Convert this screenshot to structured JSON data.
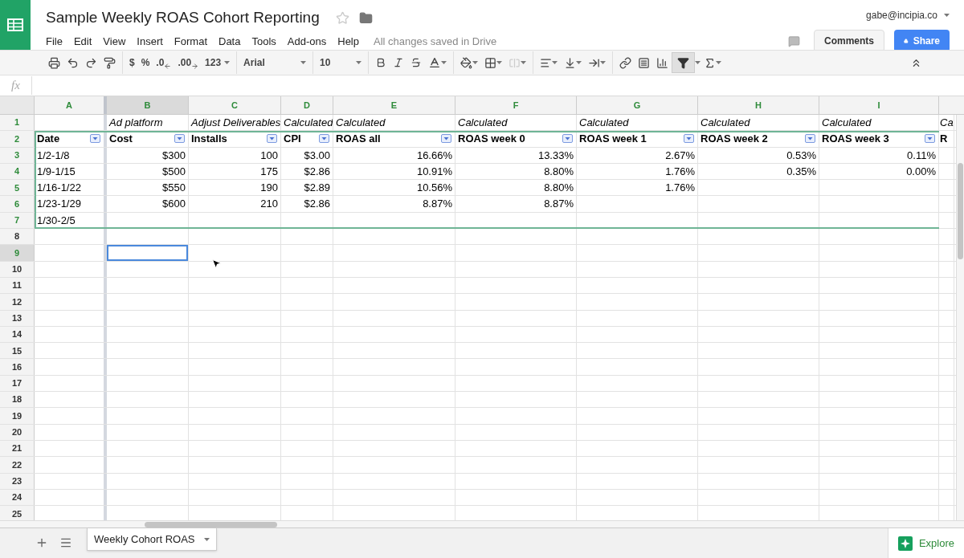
{
  "app": {
    "title": "Sample Weekly ROAS Cohort Reporting",
    "account": "gabe@incipia.co",
    "menu": [
      "File",
      "Edit",
      "View",
      "Insert",
      "Format",
      "Data",
      "Tools",
      "Add-ons",
      "Help"
    ],
    "save_status": "All changes saved in Drive",
    "comments_button": "Comments",
    "share_button": "Share"
  },
  "toolbar": {
    "currency": "$",
    "percent": "%",
    "decrease_decimals": ".0",
    "increase_decimals": ".00",
    "number_format": "123",
    "font": "Arial",
    "font_size": "10",
    "filter_on": true
  },
  "formula_bar": {
    "fx": "fx"
  },
  "sheet": {
    "columns": [
      {
        "letter": "A",
        "selected": false
      },
      {
        "letter": "B",
        "selected": true
      },
      {
        "letter": "C",
        "selected": false
      },
      {
        "letter": "D",
        "selected": false
      },
      {
        "letter": "E",
        "selected": false
      },
      {
        "letter": "F",
        "selected": false
      },
      {
        "letter": "G",
        "selected": false
      },
      {
        "letter": "H",
        "selected": false
      },
      {
        "letter": "I",
        "selected": false
      }
    ],
    "rows": [
      {
        "number": "1",
        "selected": false,
        "kind": "source",
        "cells": {
          "B": "Ad platform",
          "C": "Adjust Deliverables",
          "D": "Calculated",
          "E": "Calculated",
          "F": "Calculated",
          "G": "Calculated",
          "H": "Calculated",
          "I": "Calculated",
          "J": "Ca"
        }
      },
      {
        "number": "2",
        "selected": false,
        "kind": "header",
        "cells": {
          "A": "Date",
          "B": "Cost",
          "C": "Installs",
          "D": "CPI",
          "E": "ROAS all",
          "F": "ROAS week 0",
          "G": "ROAS week 1",
          "H": "ROAS week 2",
          "I": "ROAS week 3",
          "J": "R"
        }
      },
      {
        "number": "3",
        "selected": false,
        "kind": "data",
        "cells": {
          "A": "1/2-1/8",
          "B": "$300",
          "C": "100",
          "D": "$3.00",
          "E": "16.66%",
          "F": "13.33%",
          "G": "2.67%",
          "H": "0.53%",
          "I": "0.11%"
        }
      },
      {
        "number": "4",
        "selected": false,
        "kind": "data",
        "cells": {
          "A": "1/9-1/15",
          "B": "$500",
          "C": "175",
          "D": "$2.86",
          "E": "10.91%",
          "F": "8.80%",
          "G": "1.76%",
          "H": "0.35%",
          "I": "0.00%"
        }
      },
      {
        "number": "5",
        "selected": false,
        "kind": "data",
        "cells": {
          "A": "1/16-1/22",
          "B": "$550",
          "C": "190",
          "D": "$2.89",
          "E": "10.56%",
          "F": "8.80%",
          "G": "1.76%"
        }
      },
      {
        "number": "6",
        "selected": false,
        "kind": "data",
        "cells": {
          "A": "1/23-1/29",
          "B": "$600",
          "C": "210",
          "D": "$2.86",
          "E": "8.87%",
          "F": "8.87%"
        }
      },
      {
        "number": "7",
        "selected": false,
        "kind": "data",
        "cells": {
          "A": "1/30-2/5"
        }
      },
      {
        "number": "8",
        "selected": false,
        "kind": "data",
        "cells": {}
      },
      {
        "number": "9",
        "selected": true,
        "kind": "data",
        "cells": {}
      },
      {
        "number": "10",
        "selected": false,
        "kind": "data",
        "cells": {}
      },
      {
        "number": "11",
        "selected": false,
        "kind": "data",
        "cells": {}
      },
      {
        "number": "12",
        "selected": false,
        "kind": "data",
        "cells": {}
      },
      {
        "number": "13",
        "selected": false,
        "kind": "data",
        "cells": {}
      },
      {
        "number": "14",
        "selected": false,
        "kind": "data",
        "cells": {}
      },
      {
        "number": "15",
        "selected": false,
        "kind": "data",
        "cells": {}
      },
      {
        "number": "16",
        "selected": false,
        "kind": "data",
        "cells": {}
      },
      {
        "number": "17",
        "selected": false,
        "kind": "data",
        "cells": {}
      },
      {
        "number": "18",
        "selected": false,
        "kind": "data",
        "cells": {}
      },
      {
        "number": "19",
        "selected": false,
        "kind": "data",
        "cells": {}
      },
      {
        "number": "20",
        "selected": false,
        "kind": "data",
        "cells": {}
      },
      {
        "number": "21",
        "selected": false,
        "kind": "data",
        "cells": {}
      },
      {
        "number": "22",
        "selected": false,
        "kind": "data",
        "cells": {}
      },
      {
        "number": "23",
        "selected": false,
        "kind": "data",
        "cells": {}
      },
      {
        "number": "24",
        "selected": false,
        "kind": "data",
        "cells": {}
      },
      {
        "number": "25",
        "selected": false,
        "kind": "data",
        "cells": {}
      }
    ]
  },
  "sheet_tabs": [
    {
      "label": "Weekly Cohort ROAS",
      "selected": true
    }
  ],
  "explore_button": "Explore"
}
